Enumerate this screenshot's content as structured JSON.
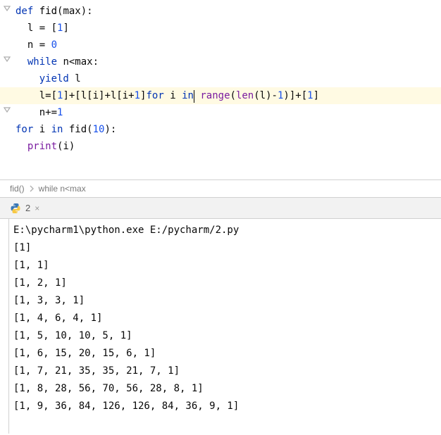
{
  "code": {
    "lines": [
      [
        {
          "t": "def ",
          "c": "kw"
        },
        {
          "t": "fid",
          "c": "fn"
        },
        {
          "t": "(max):",
          "c": "plain"
        }
      ],
      [
        {
          "t": "  l = [",
          "c": "plain"
        },
        {
          "t": "1",
          "c": "num"
        },
        {
          "t": "]",
          "c": "plain"
        }
      ],
      [
        {
          "t": "  n = ",
          "c": "plain"
        },
        {
          "t": "0",
          "c": "num"
        }
      ],
      [
        {
          "t": "  ",
          "c": "plain"
        },
        {
          "t": "while ",
          "c": "kw"
        },
        {
          "t": "n<max:",
          "c": "plain"
        }
      ],
      [
        {
          "t": "    ",
          "c": "plain"
        },
        {
          "t": "yield ",
          "c": "kw"
        },
        {
          "t": "l",
          "c": "plain"
        }
      ],
      [
        {
          "t": "    l=[",
          "c": "plain"
        },
        {
          "t": "1",
          "c": "num"
        },
        {
          "t": "]+[l[i]+l[i+",
          "c": "plain"
        },
        {
          "t": "1",
          "c": "num"
        },
        {
          "t": "]",
          "c": "plain"
        },
        {
          "t": "for ",
          "c": "kw"
        },
        {
          "t": "i ",
          "c": "plain"
        },
        {
          "t": "in",
          "c": "kw"
        },
        {
          "t": "",
          "c": "caret"
        },
        {
          "t": " ",
          "c": "plain"
        },
        {
          "t": "range",
          "c": "builtin"
        },
        {
          "t": "(",
          "c": "plain"
        },
        {
          "t": "len",
          "c": "builtin"
        },
        {
          "t": "(l)-",
          "c": "plain"
        },
        {
          "t": "1",
          "c": "num"
        },
        {
          "t": ")]+[",
          "c": "plain"
        },
        {
          "t": "1",
          "c": "num"
        },
        {
          "t": "]",
          "c": "plain"
        }
      ],
      [
        {
          "t": "    n+=",
          "c": "plain"
        },
        {
          "t": "1",
          "c": "num"
        }
      ],
      [
        {
          "t": "for ",
          "c": "kw"
        },
        {
          "t": "i ",
          "c": "plain"
        },
        {
          "t": "in ",
          "c": "kw"
        },
        {
          "t": "fid(",
          "c": "plain"
        },
        {
          "t": "10",
          "c": "num"
        },
        {
          "t": "):",
          "c": "plain"
        }
      ],
      [
        {
          "t": "  ",
          "c": "plain"
        },
        {
          "t": "print",
          "c": "builtin"
        },
        {
          "t": "(i)",
          "c": "plain"
        }
      ]
    ],
    "currentLineIndex": 5,
    "folds": [
      0,
      3,
      6
    ]
  },
  "breadcrumb": {
    "items": [
      "fid()",
      "while n<max"
    ]
  },
  "runTab": {
    "label": "2"
  },
  "console": {
    "command": "E:\\pycharm1\\python.exe E:/pycharm/2.py",
    "output": [
      "[1]",
      "[1, 1]",
      "[1, 2, 1]",
      "[1, 3, 3, 1]",
      "[1, 4, 6, 4, 1]",
      "[1, 5, 10, 10, 5, 1]",
      "[1, 6, 15, 20, 15, 6, 1]",
      "[1, 7, 21, 35, 35, 21, 7, 1]",
      "[1, 8, 28, 56, 70, 56, 28, 8, 1]",
      "[1, 9, 36, 84, 126, 126, 84, 36, 9, 1]"
    ]
  }
}
